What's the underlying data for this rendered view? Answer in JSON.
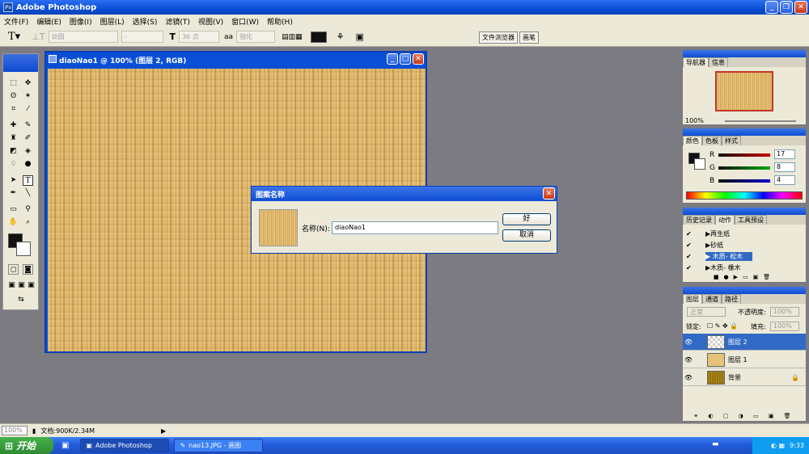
{
  "app": {
    "title": "Adobe Photoshop"
  },
  "menu": [
    "文件(F)",
    "编辑(E)",
    "图像(I)",
    "图层(L)",
    "选择(S)",
    "滤镜(T)",
    "视图(V)",
    "窗口(W)",
    "帮助(H)"
  ],
  "options": {
    "font_family": "幼圆",
    "font_size": "36 点",
    "aa": "锐化",
    "tab_file": "文件浏览器",
    "tab_brush": "画笔"
  },
  "document": {
    "title": "diaoNao1 @ 100% (图层 2, RGB)"
  },
  "dialog": {
    "title": "图案名称",
    "name_label": "名称(N):",
    "name_value": "diaoNao1",
    "ok": "好",
    "cancel": "取消"
  },
  "navigator": {
    "tabs": [
      "导航器",
      "信息"
    ],
    "zoom": "100%"
  },
  "color": {
    "tabs": [
      "颜色",
      "色板",
      "样式"
    ],
    "r_label": "R",
    "g_label": "G",
    "b_label": "B",
    "r": "17",
    "g": "8",
    "b": "4"
  },
  "actions": {
    "tabs": [
      "历史记录",
      "动作",
      "工具预设"
    ],
    "items": [
      "再生纸",
      "砂纸",
      "木质- 松木",
      "木质- 橡木"
    ]
  },
  "layers": {
    "tabs": [
      "图层",
      "通道",
      "路径"
    ],
    "mode": "正常",
    "opacity_label": "不透明度:",
    "opacity": "100%",
    "lock_label": "锁定:",
    "fill_label": "填充:",
    "fill": "100%",
    "items": [
      "图层 2",
      "图层 1",
      "背景"
    ]
  },
  "status": {
    "zoom": "100%",
    "doc": "文档:900K/2.34M"
  },
  "taskbar": {
    "start": "开始",
    "items": [
      "Adobe Photoshop",
      "nao13.JPG - 画图"
    ],
    "time": "9:33"
  },
  "colors": {
    "accent": "#0a4fd6",
    "wood_light": "#e6c27a",
    "wood_dark": "#b98c42"
  }
}
